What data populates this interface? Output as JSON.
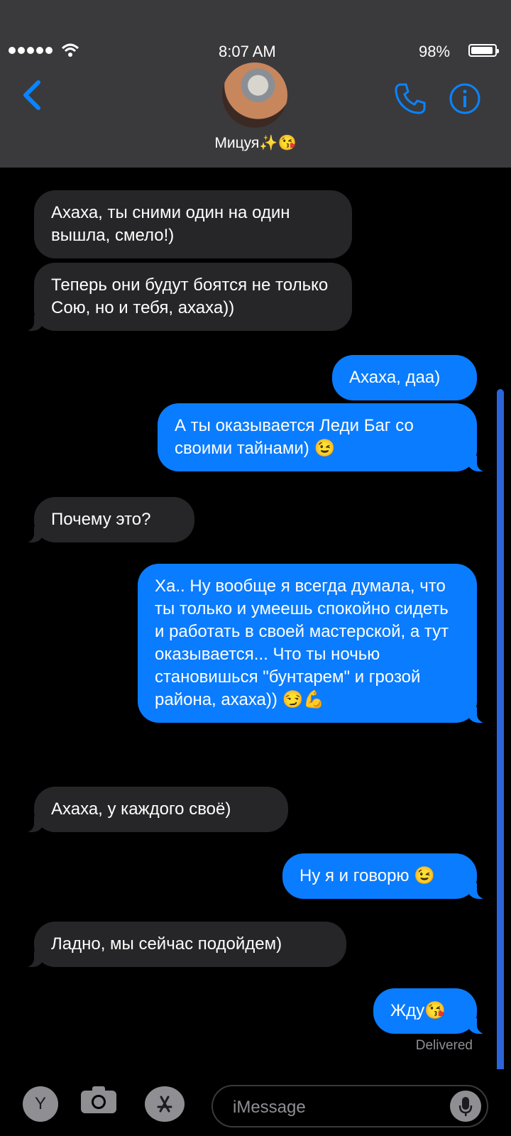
{
  "status_bar": {
    "time": "8:07 AM",
    "battery": "98%",
    "battery_level": 0.98
  },
  "header": {
    "contact_name": "Мицуя✨😘",
    "back_icon": "chevron-left-icon",
    "call_icon": "phone-icon",
    "info_icon": "info-icon"
  },
  "messages": [
    {
      "direction": "incoming",
      "text": "Ахаха, ты сними один на один вышла, смело!)"
    },
    {
      "direction": "incoming",
      "text": "Теперь они будут боятся не только Сою, но и тебя, ахаха))"
    },
    {
      "direction": "outgoing",
      "text": "Ахаха, даа)"
    },
    {
      "direction": "outgoing",
      "text": "А ты оказывается Леди Баг со своими тайнами) 😉"
    },
    {
      "direction": "incoming",
      "text": "Почему это?"
    },
    {
      "direction": "outgoing",
      "text": "Ха.. Ну вообще я всегда думала, что ты только и умеешь спокойно сидеть и работать в своей мастерской, а тут оказывается... Что ты ночью становишься \"бунтарем\" и грозой района, ахаха)) 😏💪"
    },
    {
      "direction": "incoming",
      "text": "Ахаха, у каждого своё)"
    },
    {
      "direction": "outgoing",
      "text": "Ну я и говорю 😉"
    },
    {
      "direction": "incoming",
      "text": "Ладно, мы сейчас подойдем)"
    },
    {
      "direction": "outgoing",
      "text": "Жду😘"
    }
  ],
  "delivered_label": "Delivered",
  "input": {
    "avatar_letter": "Y",
    "placeholder": "iMessage"
  }
}
